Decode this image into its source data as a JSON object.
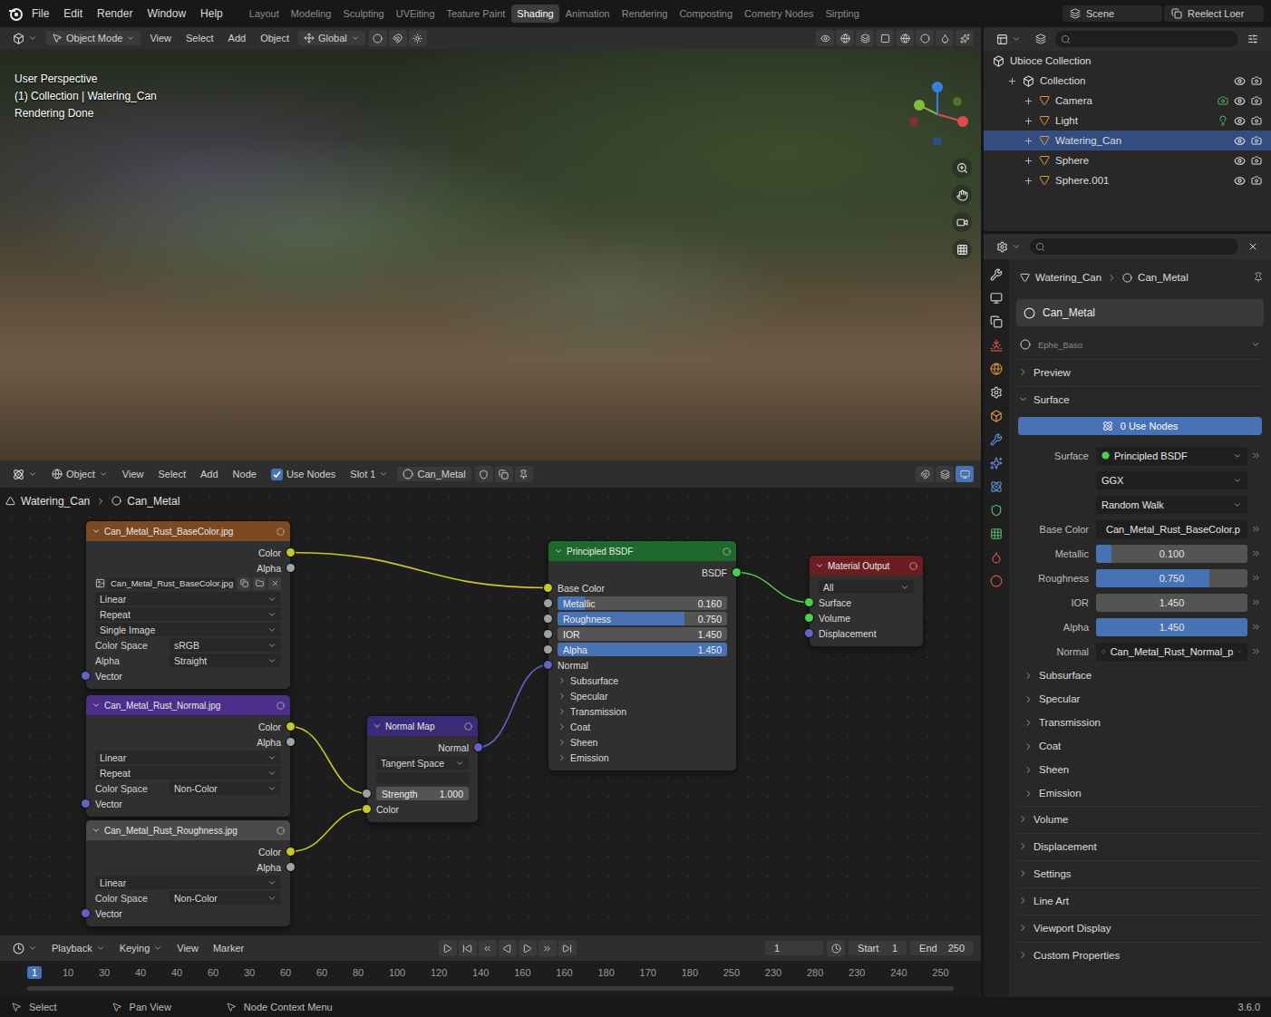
{
  "topbar": {
    "menus": [
      "File",
      "Edit",
      "Render",
      "Window",
      "Help"
    ],
    "workspaces": [
      {
        "label": "Layout",
        "selected": false
      },
      {
        "label": "Modeling",
        "selected": false
      },
      {
        "label": "Sculpting",
        "selected": false
      },
      {
        "label": "UVEiting",
        "selected": false
      },
      {
        "label": "Teature Paint",
        "selected": false
      },
      {
        "label": "Shading",
        "selected": true
      },
      {
        "label": "Animation",
        "selected": false
      },
      {
        "label": "Rendering",
        "selected": false
      },
      {
        "label": "Composting",
        "selected": false
      },
      {
        "label": "Cometry Nodes",
        "selected": false
      },
      {
        "label": "Sirpting",
        "selected": false
      }
    ],
    "scene": "Scene",
    "view_layer": "Reelect Loer"
  },
  "viewport": {
    "header": {
      "mode": "Object Mode",
      "menus": [
        "View",
        "Select",
        "Add",
        "Object"
      ],
      "orientation": "Global"
    },
    "overlay": [
      "User Perspective",
      "(1) Collection | Watering_Can",
      "Rendering Done"
    ]
  },
  "outliner": {
    "root": "Ubioce Collection",
    "items": [
      {
        "label": "Collection",
        "kind": "collection",
        "selected": false,
        "visible": true
      },
      {
        "label": "Camera",
        "kind": "object",
        "selected": false,
        "visible": true
      },
      {
        "label": "Light",
        "kind": "object",
        "selected": false,
        "visible": true
      },
      {
        "label": "Watering_Can",
        "kind": "object",
        "selected": true,
        "visible": true
      },
      {
        "label": "Sphere",
        "kind": "object",
        "selected": false,
        "visible": true
      },
      {
        "label": "Sphere.001",
        "kind": "object",
        "selected": false,
        "visible": true
      }
    ]
  },
  "node_editor": {
    "header": {
      "editor": "Object",
      "menus": [
        "View",
        "Select",
        "Add",
        "Node"
      ],
      "use_nodes": {
        "label": "Use Nodes",
        "checked": true
      },
      "slot": "Slot 1",
      "material": "Can_Metal"
    },
    "breadcrumb": [
      "Watering_Can",
      "Can_Metal"
    ],
    "nodes": [
      {
        "title": "Can_Metal_Rust_BaseColor.jpg",
        "kind": "image",
        "color": "#7b4a22",
        "rows": [
          {
            "kind": "output",
            "label": "Color",
            "socket": "#c7c729"
          },
          {
            "kind": "output",
            "label": "Alpha",
            "socket": "#a1a1a1"
          },
          {
            "kind": "file",
            "value": "Can_Metal_Rust_BaseColor.jpg"
          },
          {
            "kind": "select",
            "value": "Linear"
          },
          {
            "kind": "select",
            "value": "Repeat"
          },
          {
            "kind": "select",
            "value": "Single Image"
          },
          {
            "kind": "select",
            "label": "Color Space",
            "value": "sRGB"
          },
          {
            "kind": "select",
            "label": "Alpha",
            "value": "Straight"
          },
          {
            "kind": "input",
            "label": "Vector",
            "socket": "#6363c7"
          }
        ]
      },
      {
        "title": "Can_Metal_Rust_Normal.jpg",
        "kind": "image",
        "color": "#4b2f8a",
        "rows": [
          {
            "kind": "output",
            "label": "Color",
            "socket": "#c7c729"
          },
          {
            "kind": "output",
            "label": "Alpha",
            "socket": "#a1a1a1"
          },
          {
            "kind": "select",
            "value": "Linear"
          },
          {
            "kind": "select",
            "value": "Repeat"
          },
          {
            "kind": "select",
            "label": "Color Space",
            "value": "Non-Color"
          },
          {
            "kind": "input",
            "label": "Vector",
            "socket": "#6363c7"
          }
        ]
      },
      {
        "title": "Can_Metal_Rust_Roughness.jpg",
        "kind": "image",
        "color": "#4a4a4a",
        "rows": [
          {
            "kind": "output",
            "label": "Color",
            "socket": "#c7c729"
          },
          {
            "kind": "output",
            "label": "Alpha",
            "socket": "#a1a1a1"
          },
          {
            "kind": "select",
            "value": "Linear"
          },
          {
            "kind": "select",
            "label": "Color Space",
            "value": "Non-Color"
          },
          {
            "kind": "input",
            "label": "Vector",
            "socket": "#6363c7"
          }
        ]
      },
      {
        "title": "Normal Map",
        "kind": "normal-map",
        "color": "#3b2a78",
        "rows": [
          {
            "kind": "output",
            "label": "Normal",
            "socket": "#6363c7"
          },
          {
            "kind": "select",
            "value": "Tangent Space"
          },
          {
            "kind": "blank"
          },
          {
            "kind": "slider",
            "label": "Strength",
            "value": "1.000",
            "level": 0,
            "socket": "#a1a1a1"
          },
          {
            "kind": "input",
            "label": "Color",
            "socket": "#c7c729"
          }
        ]
      },
      {
        "title": "Principled BSDF",
        "kind": "bsdf",
        "color": "#1e6a2d",
        "rows": [
          {
            "kind": "output",
            "label": "BSDF",
            "socket": "#4dce4d"
          },
          {
            "kind": "input",
            "label": "Base Color",
            "socket": "#c7c729"
          },
          {
            "kind": "slider",
            "label": "Metallic",
            "value": "0.160",
            "level": 0.16,
            "socket": "#a1a1a1"
          },
          {
            "kind": "slider",
            "label": "Roughness",
            "value": "0.750",
            "level": 0.75,
            "socket": "#a1a1a1"
          },
          {
            "kind": "slider",
            "label": "IOR",
            "value": "1.450",
            "level": 0,
            "socket": "#a1a1a1"
          },
          {
            "kind": "slider",
            "label": "Alpha",
            "value": "1.450",
            "level": 1,
            "socket": "#a1a1a1"
          },
          {
            "kind": "input",
            "label": "Normal",
            "socket": "#6363c7"
          },
          {
            "kind": "panel",
            "label": "Subsurface"
          },
          {
            "kind": "panel",
            "label": "Specular"
          },
          {
            "kind": "panel",
            "label": "Transmission"
          },
          {
            "kind": "panel",
            "label": "Coat"
          },
          {
            "kind": "panel",
            "label": "Sheen"
          },
          {
            "kind": "panel",
            "label": "Emission"
          }
        ]
      },
      {
        "title": "Material Output",
        "kind": "output",
        "color": "#6b1e22",
        "rows": [
          {
            "kind": "select",
            "value": "All"
          },
          {
            "kind": "input",
            "label": "Surface",
            "socket": "#4dce4d"
          },
          {
            "kind": "input",
            "label": "Volume",
            "socket": "#4dce4d"
          },
          {
            "kind": "input",
            "label": "Displacement",
            "socket": "#6363c7"
          }
        ]
      }
    ]
  },
  "properties": {
    "breadcrumb": [
      "Watering_Can",
      "Can_Metal"
    ],
    "material_slot": "Can_Metal",
    "datablock": "Ephe_Baso",
    "sections": [
      {
        "label": "Preview",
        "expanded": false
      },
      {
        "label": "Surface",
        "expanded": true
      }
    ],
    "use_nodes": "0 Use Nodes",
    "fields": [
      {
        "kind": "link",
        "label": "Surface",
        "value": "Principled BSDF"
      },
      {
        "kind": "select",
        "value": "GGX"
      },
      {
        "kind": "select",
        "value": "Random Walk"
      },
      {
        "kind": "link",
        "label": "Base Color",
        "value": "Can_Metal_Rust_BaseColor.p"
      },
      {
        "kind": "slider",
        "label": "Metallic",
        "value": "0.100",
        "level": 0.1
      },
      {
        "kind": "slider",
        "label": "Roughness",
        "value": "0.750",
        "level": 0.75
      },
      {
        "kind": "slider",
        "label": "IOR",
        "value": "1.450",
        "level": 0
      },
      {
        "kind": "slider",
        "label": "Alpha",
        "value": "1.450",
        "level": 1
      },
      {
        "kind": "link",
        "label": "Normal",
        "value": "Can_Metal_Rust_Normal_p"
      }
    ],
    "subpanels": [
      {
        "label": "Subsurface",
        "expanded": false
      },
      {
        "label": "Specular",
        "expanded": false
      },
      {
        "label": "Transmission",
        "expanded": false
      },
      {
        "label": "Coat",
        "expanded": false
      },
      {
        "label": "Sheen",
        "expanded": false
      },
      {
        "label": "Emission",
        "expanded": false
      }
    ],
    "panels": [
      {
        "label": "Volume",
        "expanded": false
      },
      {
        "label": "Displacement",
        "expanded": false
      },
      {
        "label": "Settings",
        "expanded": false
      },
      {
        "label": "Line Art",
        "expanded": false
      },
      {
        "label": "Viewport Display",
        "expanded": false
      },
      {
        "label": "Custom Properties",
        "expanded": false
      }
    ]
  },
  "timeline": {
    "menus": [
      "Playback",
      "Keying",
      "View",
      "Marker"
    ],
    "frame": "1",
    "start": {
      "label": "Start",
      "value": "1"
    },
    "end": {
      "label": "End",
      "value": "250"
    },
    "ticks": [
      {
        "label": "1",
        "current": true
      },
      {
        "label": "10",
        "current": false
      },
      {
        "label": "30",
        "current": false
      },
      {
        "label": "40",
        "current": false
      },
      {
        "label": "40",
        "current": false
      },
      {
        "label": "60",
        "current": false
      },
      {
        "label": "30",
        "current": false
      },
      {
        "label": "60",
        "current": false
      },
      {
        "label": "60",
        "current": false
      },
      {
        "label": "80",
        "current": false
      },
      {
        "label": "100",
        "current": false
      },
      {
        "label": "120",
        "current": false
      },
      {
        "label": "140",
        "current": false
      },
      {
        "label": "160",
        "current": false
      },
      {
        "label": "160",
        "current": false
      },
      {
        "label": "180",
        "current": false
      },
      {
        "label": "170",
        "current": false
      },
      {
        "label": "180",
        "current": false
      },
      {
        "label": "250",
        "current": false
      },
      {
        "label": "230",
        "current": false
      },
      {
        "label": "280",
        "current": false
      },
      {
        "label": "230",
        "current": false
      },
      {
        "label": "240",
        "current": false
      },
      {
        "label": "250",
        "current": false
      }
    ]
  },
  "status_bar": {
    "hints": [
      "Select",
      "Pan View",
      "Node Context Menu"
    ],
    "version": "3.6.0"
  }
}
